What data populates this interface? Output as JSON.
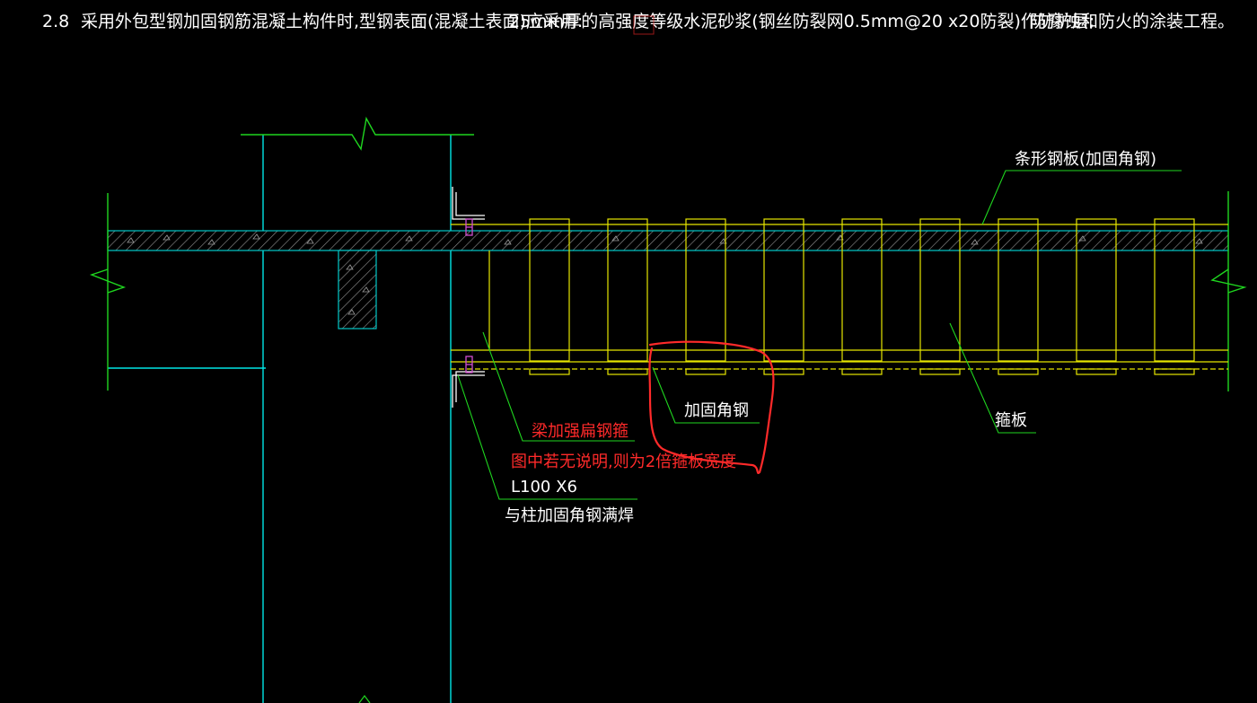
{
  "header_note": {
    "number": "2.8",
    "text1": "采用外包型钢加固钢筋混凝土构件时,型钢表面(混凝土表面)应采用:",
    "text2": "25mm厚的高强度等级水泥砂浆(钢丝防裂网0.5mm@20 x20防裂)作防护层;",
    "text3": "防腐蚀和防火的涂装工程。"
  },
  "labels": {
    "strip_plate": "条形钢板(加固角钢)",
    "hoop_plate": "箍板",
    "reinforce_angle": "加固角钢",
    "beam_flat_bar": "梁加强扁钢箍",
    "default_note": "图中若无说明,则为2倍箍板宽度",
    "angle_size": "L100 X6",
    "weld_note": "与柱加固角钢满焊"
  },
  "colors": {
    "background": "#000000",
    "column_cyan": "#00e5e5",
    "green": "#1fd61f",
    "yellow": "#e6e600",
    "white": "#ffffff",
    "red": "#ff2a2a",
    "magenta": "#d14fd1",
    "hatch": "#9a9a9a"
  }
}
